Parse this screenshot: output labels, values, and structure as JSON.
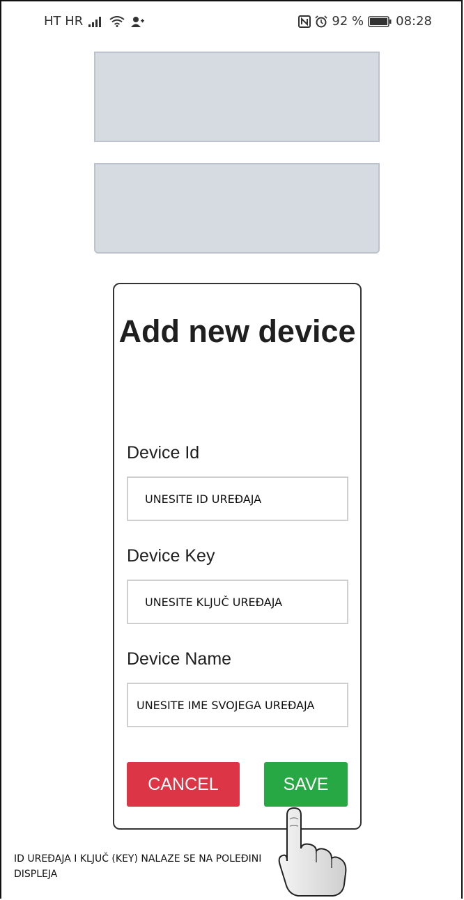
{
  "status_bar": {
    "carrier": "HT HR",
    "battery_percent": "92 %",
    "time": "08:28",
    "icons": [
      "signal-icon",
      "wifi-icon",
      "person-add-icon",
      "nfc-icon",
      "alarm-icon",
      "battery-icon"
    ]
  },
  "dialog": {
    "title": "Add new device",
    "fields": [
      {
        "label": "Device Id",
        "placeholder": "UNESITE ID UREĐAJA",
        "value": ""
      },
      {
        "label": "Device Key",
        "placeholder": "UNESITE KLJUČ UREĐAJA",
        "value": ""
      },
      {
        "label": "Device Name",
        "placeholder": "UNESITE IME SVOJEGA UREĐAJA",
        "value": ""
      }
    ],
    "cancel_label": "CANCEL",
    "save_label": "SAVE"
  },
  "footnote": "ID UREĐAJA I KLJUČ (KEY) NALAZE SE NA POLEĐINI DISPLEJA",
  "colors": {
    "placeholder_bg": "#d6dbe1",
    "cancel": "#dc3545",
    "save": "#28a745"
  }
}
